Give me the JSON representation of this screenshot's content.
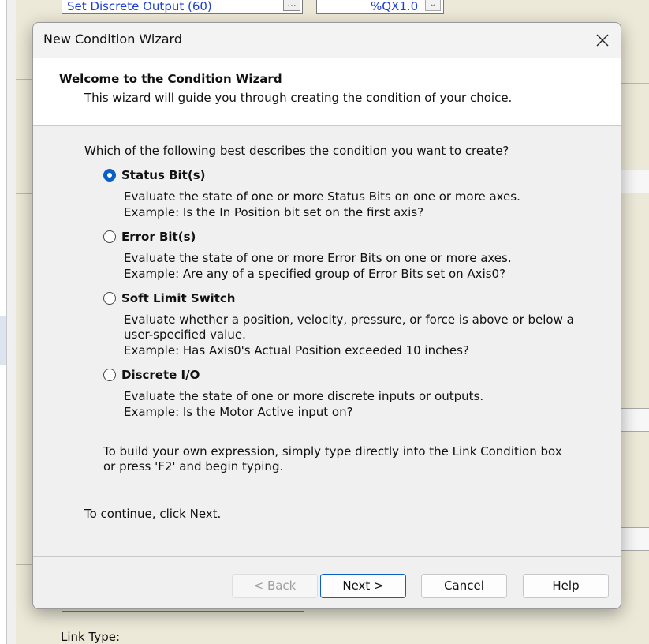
{
  "background": {
    "combo_value": "Set Discrete Output (60)",
    "ellipsis": "...",
    "address_value": "%QX1.0",
    "link_type_label": "Link Type:"
  },
  "dialog": {
    "title": "New Condition Wizard",
    "header": {
      "title": "Welcome to the Condition Wizard",
      "subtitle": "This wizard will guide you through creating the condition of your choice."
    },
    "question": "Which of the following best describes the condition you want to create?",
    "options": [
      {
        "label": "Status Bit(s)",
        "checked": true,
        "desc1": "Evaluate the state of one or more Status Bits on one or more axes.",
        "desc2": "Example: Is the In Position bit set on the first axis?"
      },
      {
        "label": "Error Bit(s)",
        "checked": false,
        "desc1": "Evaluate the state of one or more Error Bits on one or more axes.",
        "desc2": "Example: Are any of a specified group of Error Bits set on Axis0?"
      },
      {
        "label": "Soft Limit Switch",
        "checked": false,
        "desc1": "Evaluate whether a position, velocity, pressure, or force is above or below a",
        "desc2": "user-specified value.",
        "desc3": "Example: Has Axis0's Actual Position exceeded 10 inches?"
      },
      {
        "label": "Discrete I/O",
        "checked": false,
        "desc1": "Evaluate the state of one or more discrete inputs or outputs.",
        "desc2": "Example: Is the Motor Active input on?"
      }
    ],
    "hint1": "To build your own expression, simply type directly into the Link Condition box",
    "hint2": "or press 'F2' and begin typing.",
    "continue_text": "To continue, click Next.",
    "buttons": {
      "back": "< Back",
      "next": "Next >",
      "cancel": "Cancel",
      "help": "Help"
    }
  },
  "colors": {
    "accent": "#0a5fc4",
    "background_app": "#ece9d8"
  }
}
